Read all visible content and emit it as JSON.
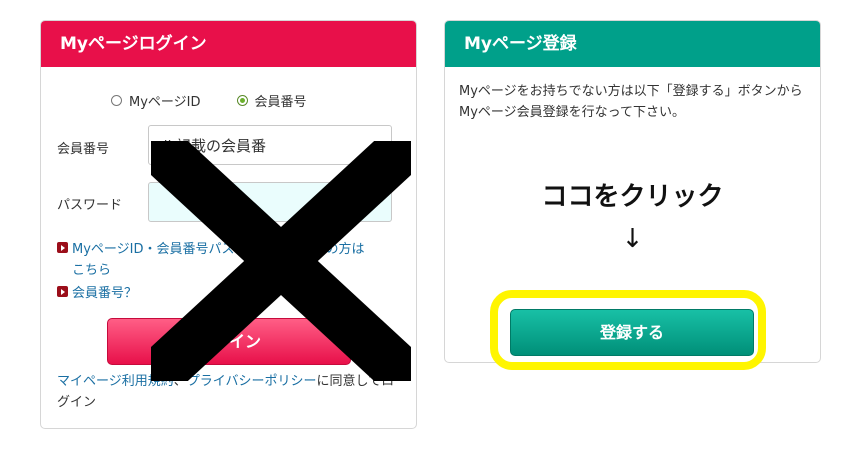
{
  "login": {
    "title": "Myページログイン",
    "radio": {
      "option1": "MyページID",
      "option2": "会員番号",
      "selected": "会員番号"
    },
    "member_label": "会員番号",
    "member_value": "ル記載の会員番",
    "password_label": "パスワード",
    "forgot_link": "MyページID・会員番号パスワードをお忘れの方は",
    "forgot_link_line2": "こちら",
    "member_link": "会員番号？",
    "login_button": "ログイン",
    "terms_link": "マイページ利用規約",
    "separator": "、",
    "privacy_link": "プライバシーポリシー",
    "agree_suffix": "に同意してログイン"
  },
  "register": {
    "title": "Myページ登録",
    "description": "Myページをお持ちでない方は以下「登録する」ボタンからMyページ会員登録を行なって下さい。",
    "annotation": "ココをクリック",
    "arrow": "↓",
    "button": "登録する"
  },
  "colors": {
    "login_header": "#e8104a",
    "register_header": "#00a08a",
    "link": "#1a6fa3",
    "highlight": "#fff500"
  }
}
